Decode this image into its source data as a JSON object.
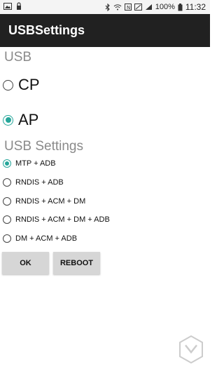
{
  "status_bar": {
    "left_icons": [
      "image-icon",
      "lock-icon"
    ],
    "right_icons": [
      "bluetooth-icon",
      "wifi-icon",
      "nfc-icon",
      "mute-icon",
      "signal-icon"
    ],
    "battery": "100%",
    "time": "11:32"
  },
  "app_bar": {
    "title": "USBSettings"
  },
  "usb_section": {
    "label": "USB",
    "options": [
      {
        "label": "CP",
        "checked": false
      },
      {
        "label": "AP",
        "checked": true
      }
    ]
  },
  "usb_settings_section": {
    "label": "USB Settings",
    "options": [
      {
        "label": "MTP + ADB",
        "checked": true
      },
      {
        "label": "RNDIS + ADB",
        "checked": false
      },
      {
        "label": "RNDIS + ACM + DM",
        "checked": false
      },
      {
        "label": "RNDIS + ACM + DM + ADB",
        "checked": false
      },
      {
        "label": "DM + ACM + ADB",
        "checked": false
      }
    ]
  },
  "buttons": {
    "ok": "OK",
    "reboot": "REBOOT"
  },
  "colors": {
    "accent": "#26a69a",
    "app_bar": "#212121",
    "status_bar": "#f4f4f4"
  }
}
